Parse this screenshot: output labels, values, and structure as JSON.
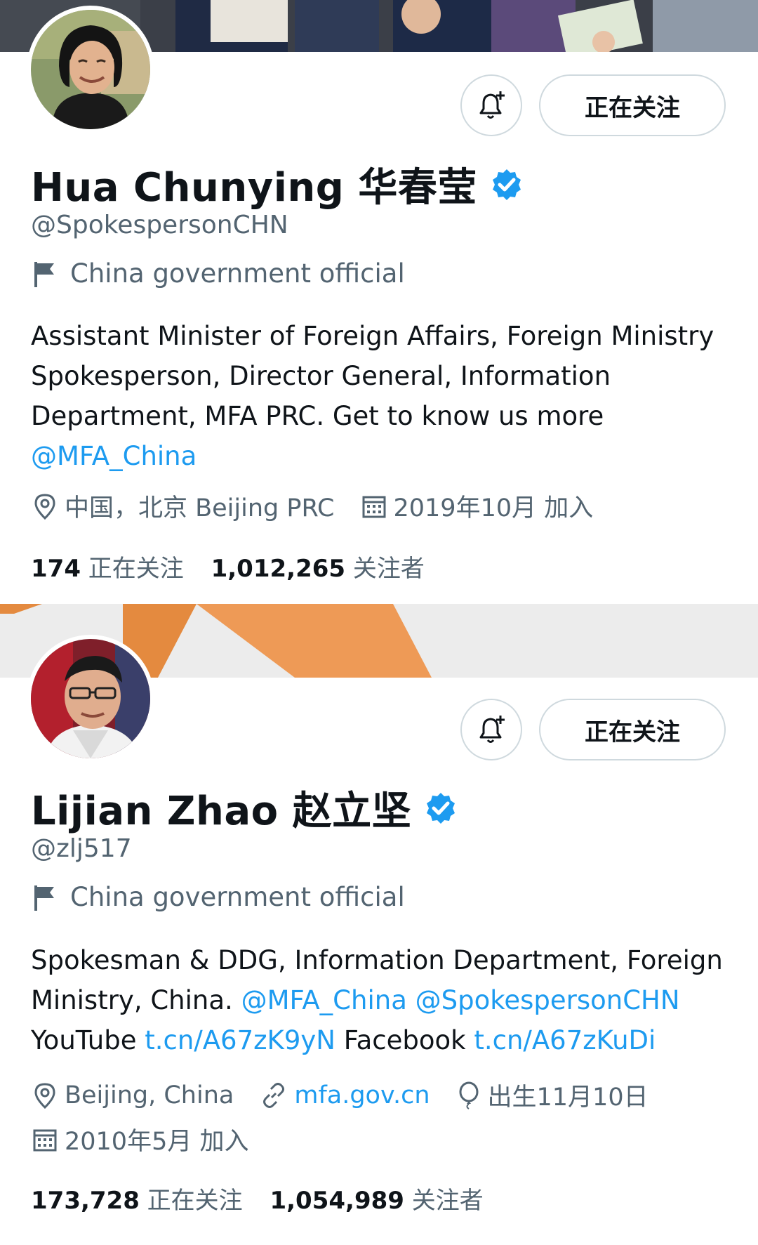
{
  "profiles": [
    {
      "name": "Hua Chunying 华春莹",
      "handle": "@SpokespersonCHN",
      "label": "China government official",
      "bio": {
        "text": "Assistant Minister of Foreign Affairs, Foreign Ministry Spokesperson, Director General, Information Department, MFA PRC. Get to know us more ",
        "mention": "@MFA_China"
      },
      "location": "中国，北京 Beijing PRC",
      "joined": "2019年10月 加入",
      "following_count": "174",
      "following_label": "正在关注",
      "followers_count": "1,012,265",
      "followers_label": "关注者",
      "follow_button": "正在关注",
      "bell_icon": "bell-plus-icon"
    },
    {
      "name": "Lijian Zhao 赵立坚",
      "handle": "@zlj517",
      "label": "China government official",
      "bio": {
        "t1": "Spokesman & DDG, Information Department, Foreign Ministry, China. ",
        "l1": "@MFA_China",
        "t2": " ",
        "l2": "@SpokespersonCHN",
        "t3": " YouTube ",
        "l3": "t.cn/A67zK9yN",
        "t4": " Facebook ",
        "l4": "t.cn/A67zKuDi"
      },
      "location": "Beijing, China",
      "website": "mfa.gov.cn",
      "birthday": "出生11月10日",
      "joined": "2010年5月 加入",
      "following_count": "173,728",
      "following_label": "正在关注",
      "followers_count": "1,054,989",
      "followers_label": "关注者",
      "follow_button": "正在关注",
      "bell_icon": "bell-plus-icon"
    }
  ],
  "colors": {
    "link": "#1d9bf0",
    "secondary_text": "#536471",
    "primary_text": "#0f1419",
    "verified": "#1d9bf0",
    "border": "#cfd9de"
  }
}
